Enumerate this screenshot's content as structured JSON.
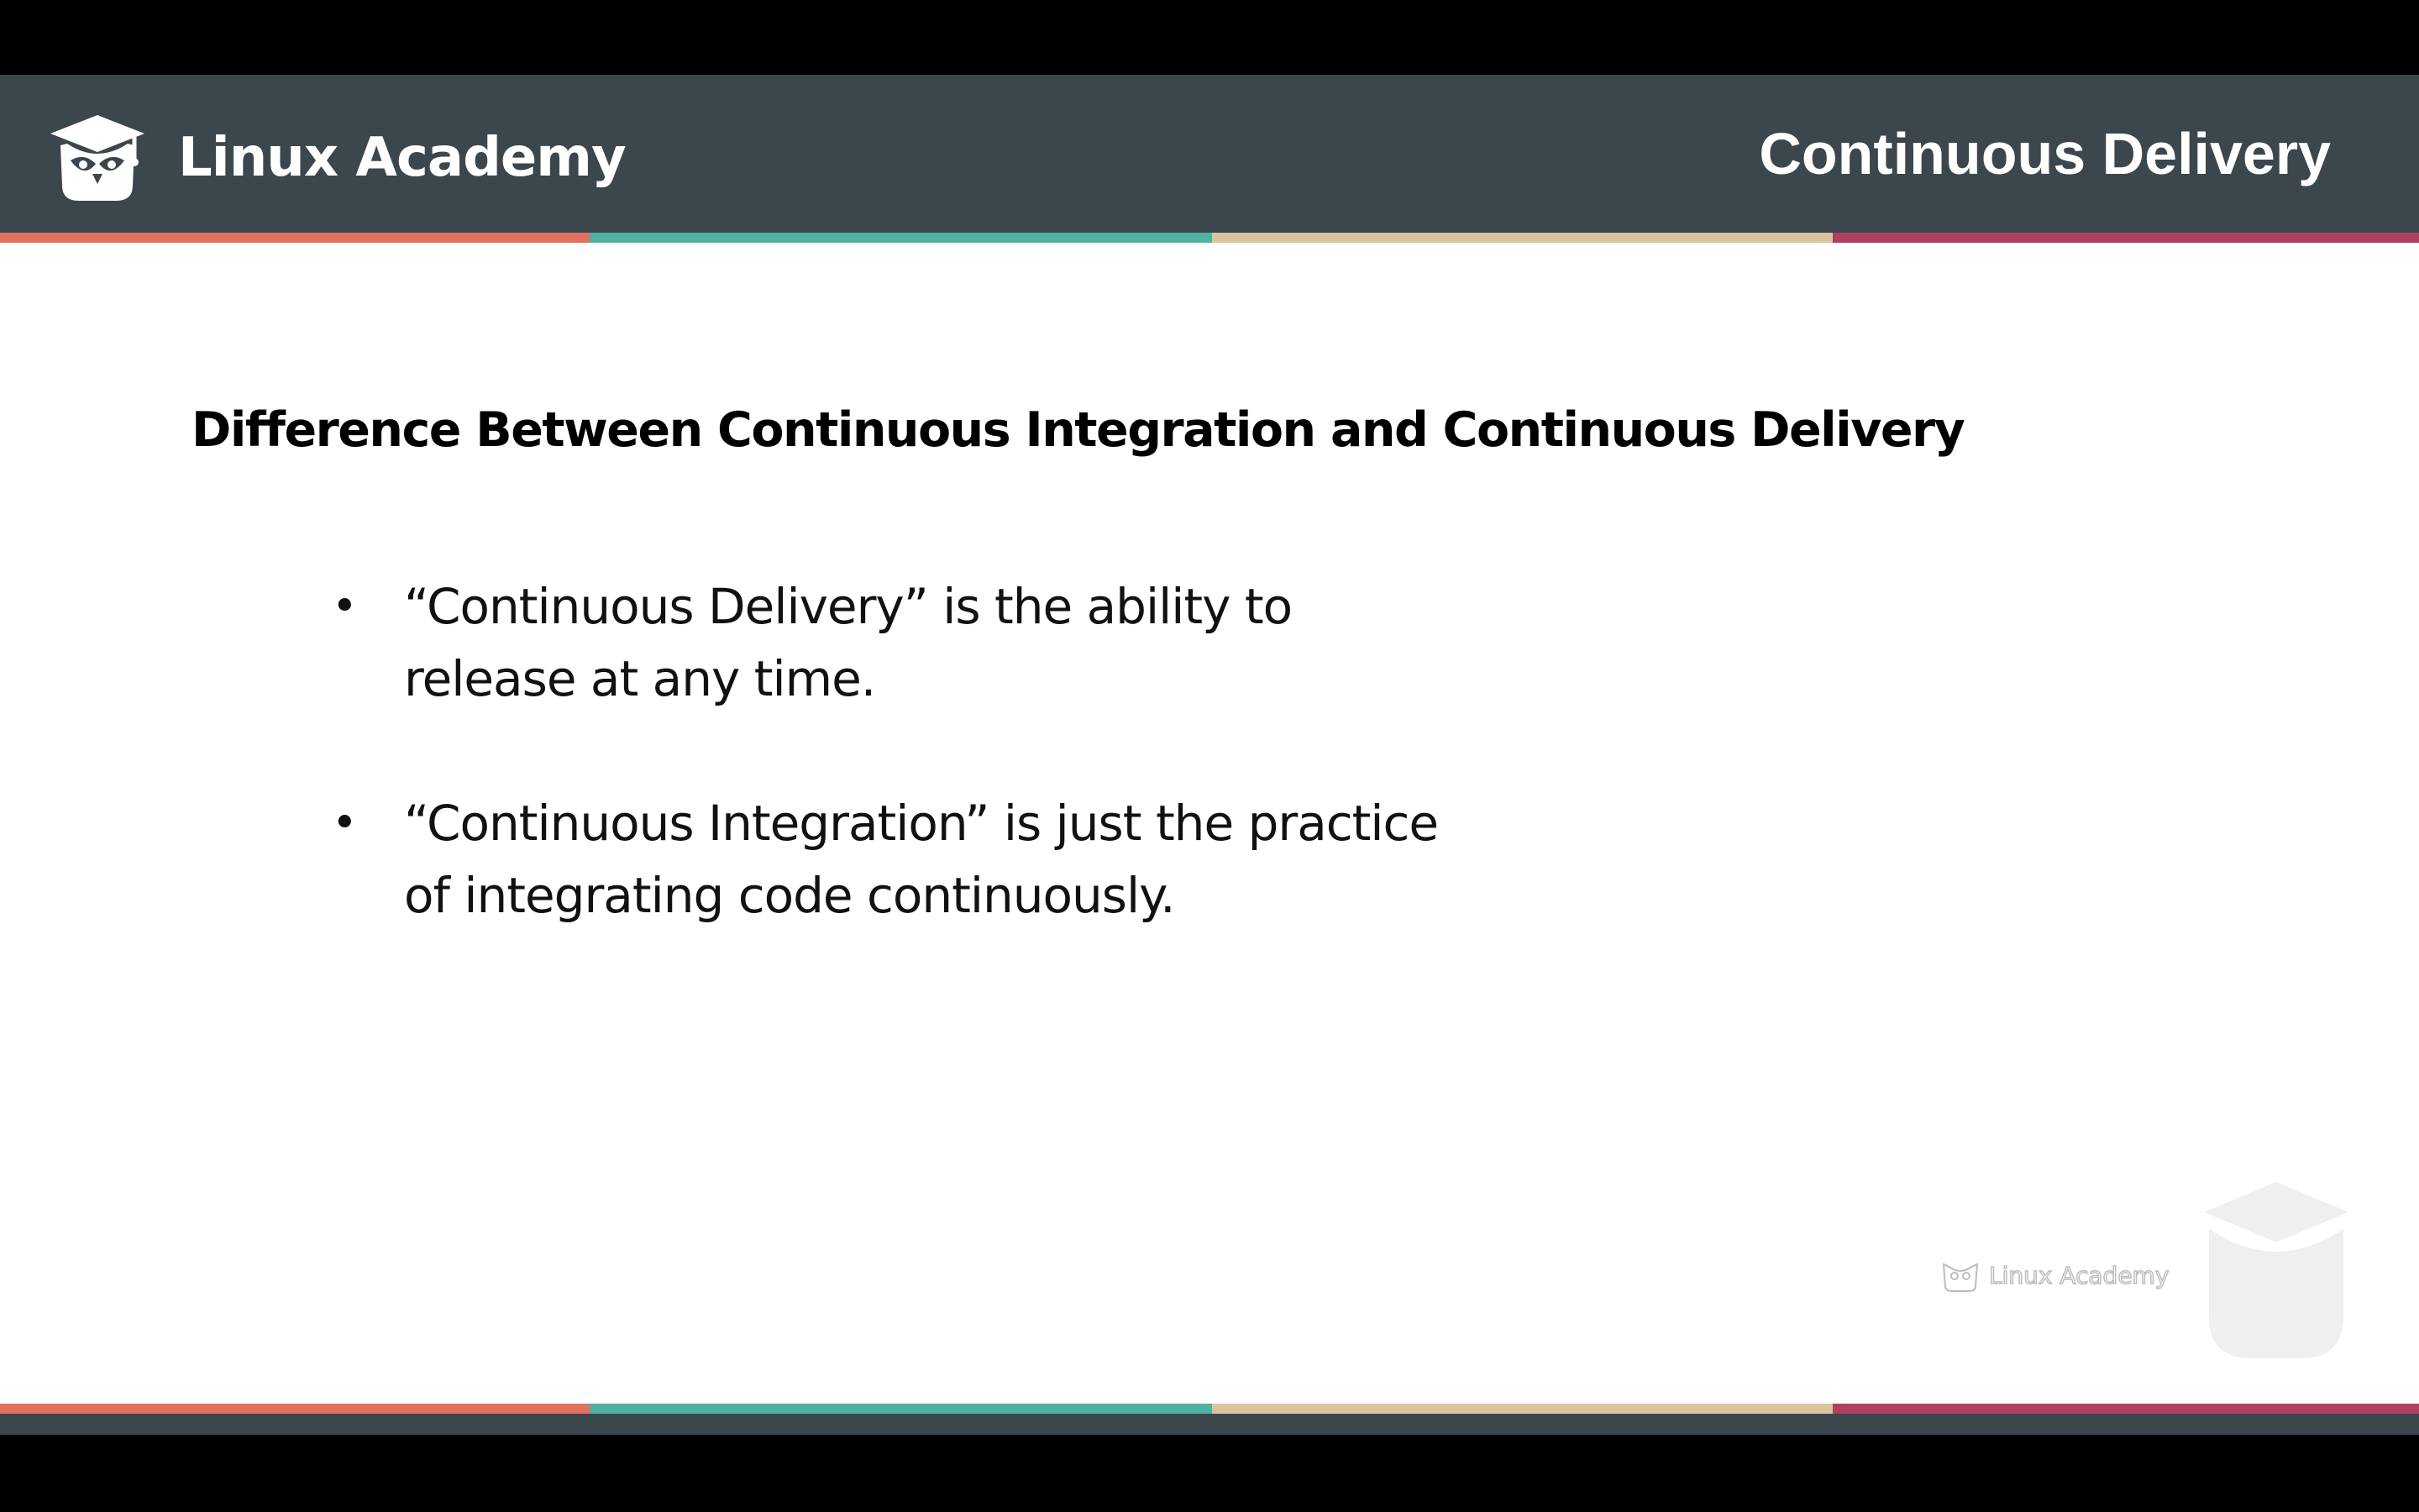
{
  "header": {
    "brand": "Linux Academy",
    "title": "Continuous Delivery"
  },
  "slide": {
    "heading": "Difference Between Continuous Integration and Continuous Delivery",
    "bullets": [
      {
        "line1": "“Continuous Delivery” is the ability to",
        "line2": "release at any time."
      },
      {
        "line1": "“Continuous Integration” is just the practice",
        "line2": "of integrating code continuously."
      }
    ],
    "bullet_glyph": "•"
  },
  "watermark": {
    "brand": "Linux Academy"
  },
  "colors": {
    "header_bg": "#3c464d",
    "stripe": [
      "#e4705f",
      "#4fb2a0",
      "#d8c59d",
      "#b0405f"
    ]
  },
  "icons": {
    "logo": "owl-graduation-cap-icon"
  }
}
